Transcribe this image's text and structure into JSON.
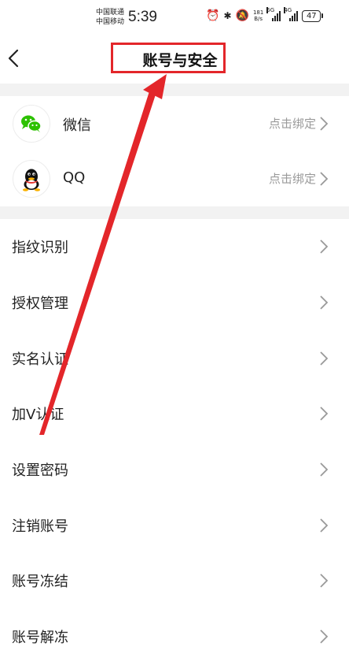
{
  "status_bar": {
    "carrier_1": "中国联通",
    "carrier_2": "中国移动",
    "time": "5:39",
    "net_speed_value": "181",
    "net_speed_unit": "B/s",
    "signal_1": "5G",
    "signal_2": "4G",
    "battery": "47"
  },
  "header": {
    "title": "账号与安全"
  },
  "social": [
    {
      "name": "微信",
      "status": "点击绑定",
      "icon": "wechat-icon"
    },
    {
      "name": "QQ",
      "status": "点击绑定",
      "icon": "qq-icon"
    }
  ],
  "settings": [
    {
      "label": "指纹识别"
    },
    {
      "label": "授权管理"
    },
    {
      "label": "实名认证"
    },
    {
      "label": "加V认证"
    },
    {
      "label": "设置密码"
    },
    {
      "label": "注销账号"
    },
    {
      "label": "账号冻结"
    },
    {
      "label": "账号解冻"
    }
  ],
  "colors": {
    "accent_annotation": "#e3262a",
    "wechat_green": "#2dc100",
    "section_gap": "#f2f2f2"
  }
}
